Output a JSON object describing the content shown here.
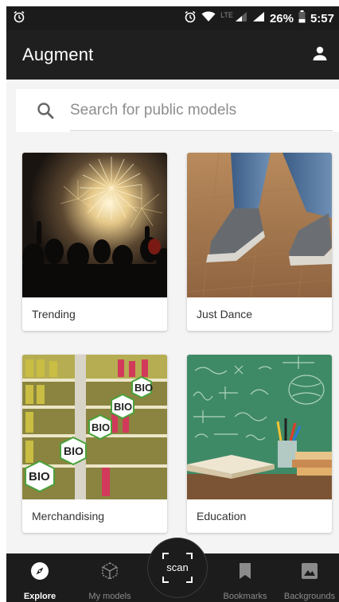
{
  "status_bar": {
    "battery": "26%",
    "time": "5:57",
    "network": "LTE"
  },
  "app_bar": {
    "title": "Augment"
  },
  "search": {
    "placeholder": "Search for public models"
  },
  "categories": [
    {
      "label": "Trending"
    },
    {
      "label": "Just Dance"
    },
    {
      "label": "Merchandising"
    },
    {
      "label": "Education"
    }
  ],
  "bottom_nav": {
    "items": [
      {
        "label": "Explore",
        "active": true
      },
      {
        "label": "My models",
        "active": false
      },
      {
        "label": "Bookmarks",
        "active": false
      },
      {
        "label": "Backgrounds",
        "active": false
      }
    ],
    "scan_label": "scan"
  },
  "colors": {
    "status_bar": "#1b1b1b",
    "app_bar": "#1f1f1f",
    "bottom_nav": "#1c1c1c",
    "content_bg": "#f4f4f4"
  }
}
